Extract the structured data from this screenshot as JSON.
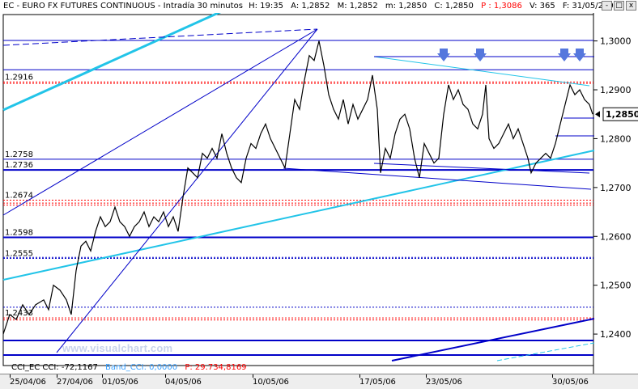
{
  "header": {
    "symbol": "EC - EURO FX FUTURES CONTINUOUS - Intradía 30 minutos",
    "time": "H: 19:35",
    "open": "A: 1,2852",
    "max": "M: 1,2852",
    "min": "m: 1,2850",
    "close": "C: 1,2850",
    "p": "P : 1,3086",
    "volume": "V: 365",
    "date": "F: 31/05/2006",
    "p_color": "#ff0000"
  },
  "window_controls": {
    "minimize": "-",
    "maximize": "□",
    "close": "x"
  },
  "footer": {
    "cci_label": "CCI_EC  CCI: -72,1167",
    "band_label": "Band_CCI: 0,0000",
    "volume_label": "P: 29.734,8169",
    "band_color": "#3aa0ff",
    "volume_color": "#ff0000"
  },
  "watermark": "www.visualchart.com",
  "colors": {
    "price": "#000000",
    "channel_dark": "#0000c8",
    "channel_light": "#22c4e8",
    "dotted_red": "#ff0000",
    "arrow": "#5577dd"
  },
  "chart_data": {
    "type": "line",
    "title": "EC - EURO FX FUTURES CONTINUOUS - Intradía 30 minutos",
    "y_axis": {
      "ylim": [
        1.2372,
        1.3054
      ],
      "ticks": [
        "1,3000",
        "1,2900",
        "1,2800",
        "1,2700",
        "1,2600",
        "1,2500",
        "1,2400"
      ],
      "tick_values": [
        1.3,
        1.29,
        1.28,
        1.27,
        1.26,
        1.25,
        1.24
      ]
    },
    "x_axis": {
      "labels": [
        "25/04/06",
        "27/04/06",
        "01/05/06",
        "04/05/06",
        "10/05/06",
        "17/05/06",
        "23/05/06",
        "30/05/06"
      ]
    },
    "current_value_label": "1,2850",
    "current_value": 1.285,
    "horizontal_levels": [
      {
        "label": "1.2916",
        "value": 1.2916,
        "style": "dotted-red"
      },
      {
        "label": "1.2758",
        "value": 1.2758,
        "style": "solid-blue"
      },
      {
        "label": "1.2736",
        "value": 1.2736,
        "style": "solid-blue-thick"
      },
      {
        "label": "1.2674",
        "value": 1.2674,
        "style": "dotted-red"
      },
      {
        "label": "1.2598",
        "value": 1.2598,
        "style": "solid-blue-thick"
      },
      {
        "label": "1.2555",
        "value": 1.2555,
        "style": "dotted-blue"
      },
      {
        "label": "1.2433",
        "value": 1.2433,
        "style": "dotted-red"
      }
    ],
    "extra_levels": [
      1.3001,
      1.2941,
      1.2913,
      1.2668,
      1.2664,
      1.2557,
      1.2455,
      1.2429,
      1.2387,
      1.2357
    ],
    "series": [
      {
        "name": "EC",
        "points": [
          [
            0,
            1.24
          ],
          [
            8,
            1.244
          ],
          [
            16,
            1.243
          ],
          [
            24,
            1.246
          ],
          [
            32,
            1.244
          ],
          [
            40,
            1.246
          ],
          [
            50,
            1.247
          ],
          [
            56,
            1.245
          ],
          [
            62,
            1.25
          ],
          [
            70,
            1.249
          ],
          [
            78,
            1.247
          ],
          [
            84,
            1.244
          ],
          [
            90,
            1.253
          ],
          [
            96,
            1.258
          ],
          [
            102,
            1.259
          ],
          [
            108,
            1.257
          ],
          [
            114,
            1.261
          ],
          [
            120,
            1.264
          ],
          [
            126,
            1.262
          ],
          [
            132,
            1.263
          ],
          [
            138,
            1.266
          ],
          [
            144,
            1.263
          ],
          [
            150,
            1.262
          ],
          [
            156,
            1.26
          ],
          [
            162,
            1.262
          ],
          [
            168,
            1.263
          ],
          [
            174,
            1.265
          ],
          [
            180,
            1.262
          ],
          [
            186,
            1.264
          ],
          [
            192,
            1.263
          ],
          [
            198,
            1.265
          ],
          [
            204,
            1.262
          ],
          [
            210,
            1.264
          ],
          [
            216,
            1.261
          ],
          [
            222,
            1.268
          ],
          [
            228,
            1.274
          ],
          [
            234,
            1.273
          ],
          [
            240,
            1.272
          ],
          [
            246,
            1.277
          ],
          [
            252,
            1.276
          ],
          [
            258,
            1.278
          ],
          [
            264,
            1.276
          ],
          [
            270,
            1.281
          ],
          [
            276,
            1.277
          ],
          [
            282,
            1.274
          ],
          [
            288,
            1.272
          ],
          [
            294,
            1.271
          ],
          [
            300,
            1.276
          ],
          [
            306,
            1.279
          ],
          [
            312,
            1.278
          ],
          [
            318,
            1.281
          ],
          [
            324,
            1.283
          ],
          [
            330,
            1.28
          ],
          [
            336,
            1.278
          ],
          [
            342,
            1.276
          ],
          [
            348,
            1.274
          ],
          [
            354,
            1.281
          ],
          [
            360,
            1.288
          ],
          [
            366,
            1.286
          ],
          [
            372,
            1.292
          ],
          [
            378,
            1.297
          ],
          [
            384,
            1.296
          ],
          [
            390,
            1.3
          ],
          [
            396,
            1.295
          ],
          [
            402,
            1.289
          ],
          [
            408,
            1.286
          ],
          [
            414,
            1.284
          ],
          [
            420,
            1.288
          ],
          [
            426,
            1.283
          ],
          [
            432,
            1.287
          ],
          [
            438,
            1.284
          ],
          [
            444,
            1.286
          ],
          [
            450,
            1.288
          ],
          [
            456,
            1.293
          ],
          [
            462,
            1.286
          ],
          [
            466,
            1.273
          ],
          [
            472,
            1.278
          ],
          [
            478,
            1.276
          ],
          [
            484,
            1.281
          ],
          [
            490,
            1.284
          ],
          [
            496,
            1.285
          ],
          [
            502,
            1.282
          ],
          [
            508,
            1.276
          ],
          [
            514,
            1.272
          ],
          [
            520,
            1.279
          ],
          [
            526,
            1.277
          ],
          [
            532,
            1.275
          ],
          [
            538,
            1.276
          ],
          [
            544,
            1.285
          ],
          [
            550,
            1.291
          ],
          [
            556,
            1.288
          ],
          [
            562,
            1.29
          ],
          [
            568,
            1.287
          ],
          [
            574,
            1.286
          ],
          [
            580,
            1.283
          ],
          [
            586,
            1.282
          ],
          [
            592,
            1.285
          ],
          [
            596,
            1.291
          ],
          [
            600,
            1.28
          ],
          [
            606,
            1.278
          ],
          [
            612,
            1.279
          ],
          [
            618,
            1.281
          ],
          [
            624,
            1.283
          ],
          [
            630,
            1.28
          ],
          [
            636,
            1.282
          ],
          [
            642,
            1.279
          ],
          [
            648,
            1.276
          ],
          [
            652,
            1.273
          ],
          [
            658,
            1.275
          ],
          [
            664,
            1.276
          ],
          [
            670,
            1.277
          ],
          [
            676,
            1.276
          ],
          [
            682,
            1.279
          ],
          [
            688,
            1.283
          ],
          [
            694,
            1.287
          ],
          [
            700,
            1.291
          ],
          [
            706,
            1.289
          ],
          [
            712,
            1.29
          ],
          [
            718,
            1.288
          ],
          [
            724,
            1.287
          ],
          [
            728,
            1.285
          ]
        ]
      }
    ]
  }
}
